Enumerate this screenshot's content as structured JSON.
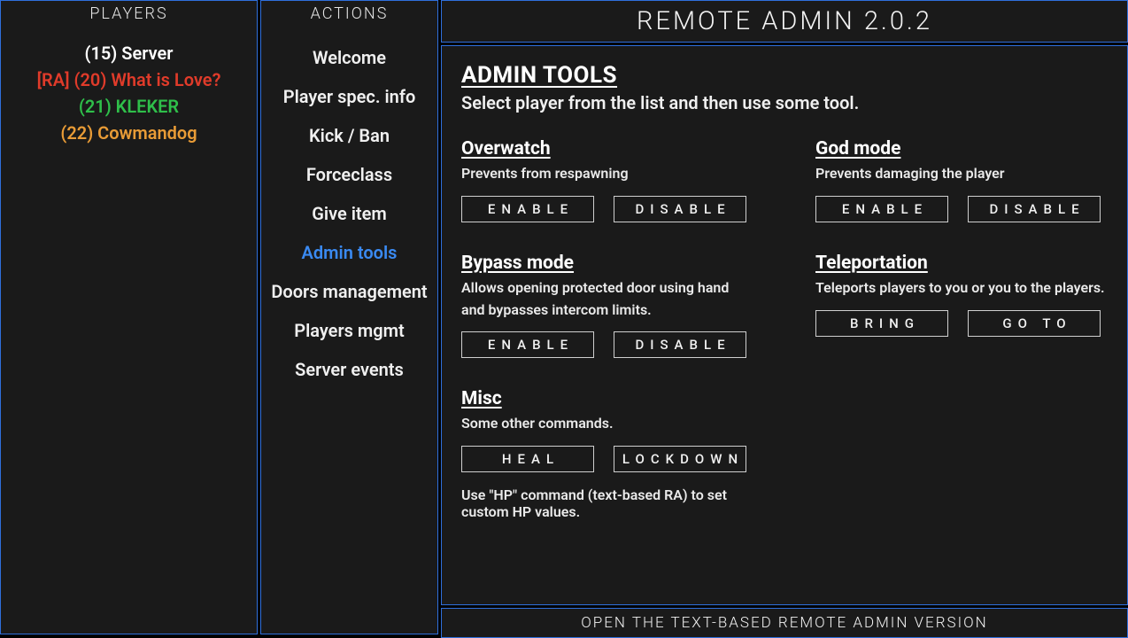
{
  "app_title": "REMOTE ADMIN 2.0.2",
  "panels": {
    "players_header": "PLAYERS",
    "actions_header": "ACTIONS"
  },
  "players": [
    {
      "label": "(15) Server",
      "color": "#ffffff"
    },
    {
      "label": "[RA] (20) What is Love?",
      "color": "#e03b2a"
    },
    {
      "label": "(21) KLEKER",
      "color": "#2fbf4a"
    },
    {
      "label": "(22) Cowmandog",
      "color": "#e89b36"
    }
  ],
  "actions": {
    "items": [
      {
        "label": "Welcome",
        "active": false
      },
      {
        "label": "Player spec. info",
        "active": false
      },
      {
        "label": "Kick / Ban",
        "active": false
      },
      {
        "label": "Forceclass",
        "active": false
      },
      {
        "label": "Give item",
        "active": false
      },
      {
        "label": "Admin tools",
        "active": true
      },
      {
        "label": "Doors management",
        "active": false
      },
      {
        "label": "Players mgmt",
        "active": false
      },
      {
        "label": "Server events",
        "active": false
      }
    ]
  },
  "main": {
    "heading": "ADMIN TOOLS",
    "subheading": "Select player from the list and then use some tool.",
    "tools": {
      "overwatch": {
        "title": "Overwatch",
        "desc": "Prevents from respawning",
        "btn1": "ENABLE",
        "btn2": "DISABLE"
      },
      "godmode": {
        "title": "God mode",
        "desc": "Prevents damaging the player",
        "btn1": "ENABLE",
        "btn2": "DISABLE"
      },
      "bypass": {
        "title": "Bypass mode",
        "desc": "Allows opening protected door using hand and bypasses intercom limits.",
        "btn1": "ENABLE",
        "btn2": "DISABLE"
      },
      "teleport": {
        "title": "Teleportation",
        "desc": "Teleports players to you or you to the players.",
        "btn1": "BRING",
        "btn2": "GO TO"
      },
      "misc": {
        "title": "Misc",
        "desc": "Some other commands.",
        "btn1": "HEAL",
        "btn2": "LOCKDOWN",
        "note": "Use \"HP\" command (text-based RA) to set custom HP values."
      }
    }
  },
  "footer": {
    "label": "OPEN THE TEXT-BASED REMOTE ADMIN VERSION"
  }
}
